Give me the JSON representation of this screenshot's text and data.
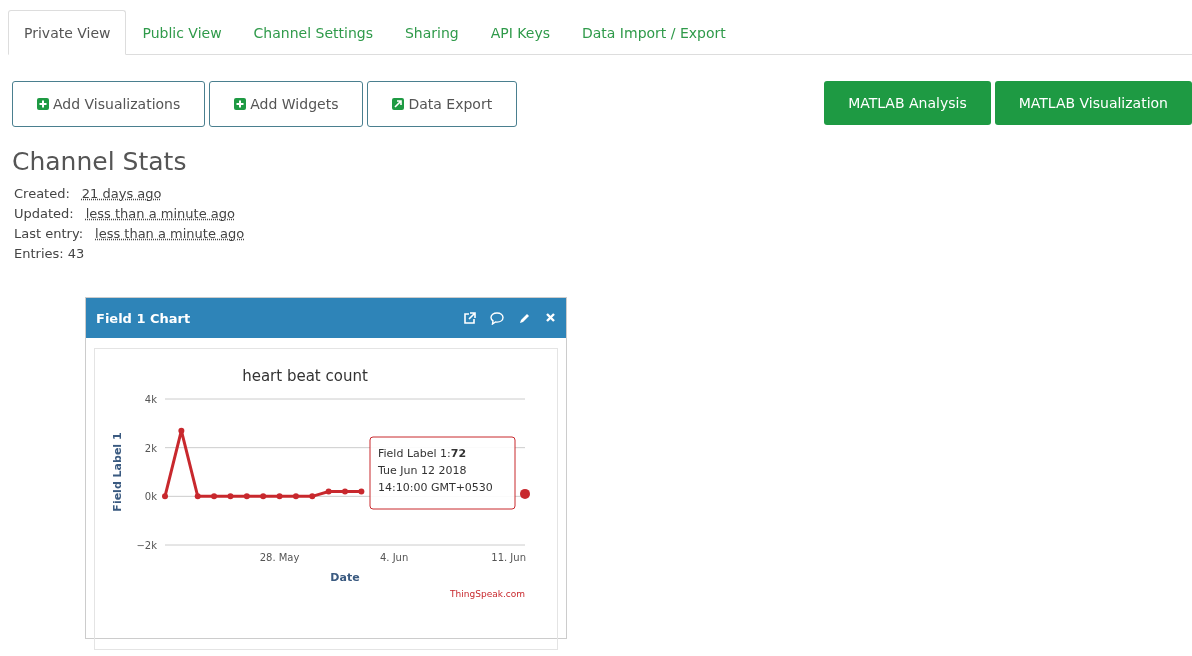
{
  "tabs": [
    {
      "label": "Private View",
      "selected": true
    },
    {
      "label": "Public View",
      "selected": false
    },
    {
      "label": "Channel Settings",
      "selected": false
    },
    {
      "label": "Sharing",
      "selected": false
    },
    {
      "label": "API Keys",
      "selected": false
    },
    {
      "label": "Data Import / Export",
      "selected": false
    }
  ],
  "toolbar": {
    "left_buttons": [
      {
        "label": "Add Visualizations",
        "kind": "add"
      },
      {
        "label": "Add Widgets",
        "kind": "add"
      },
      {
        "label": "Data Export",
        "kind": "export"
      }
    ],
    "right_buttons": [
      {
        "label": "MATLAB Analysis"
      },
      {
        "label": "MATLAB Visualization"
      }
    ]
  },
  "channel_stats": {
    "title": "Channel Stats",
    "items": [
      {
        "label": "Created:",
        "value": "21 days ago",
        "kind": "link"
      },
      {
        "label": "Updated:",
        "value": "less than a minute ago",
        "kind": "link"
      },
      {
        "label": "Last entry:",
        "value": "less than a minute ago",
        "kind": "link"
      },
      {
        "label": "Entries:",
        "value": "43",
        "kind": "plain"
      }
    ]
  },
  "chart_card": {
    "title": "Field 1 Chart",
    "credit": "ThingSpeak.com",
    "tooltip": {
      "lines": [
        "Field Label 1:**72**",
        "Tue Jun 12 2018",
        "14:10:00 GMT+0530"
      ]
    },
    "chart_data": {
      "type": "line",
      "title": "heart beat count",
      "xlabel": "Date",
      "ylabel": "Field Label 1",
      "categories": [
        null,
        null,
        null,
        null,
        null,
        null,
        null,
        "28. May",
        null,
        null,
        null,
        null,
        null,
        null,
        "4. Jun",
        null,
        null,
        null,
        null,
        null,
        null,
        "11. Jun",
        null
      ],
      "series": [
        {
          "color": "#c8282d",
          "marker": true,
          "values": [
            0,
            2700,
            0,
            0,
            0,
            0,
            0,
            0,
            0,
            0,
            200,
            200,
            200,
            null,
            null,
            null,
            null,
            null,
            null,
            null,
            null,
            null,
            100
          ]
        }
      ],
      "ylim": [
        -2000,
        4000
      ],
      "yticks": [
        {
          "value": -2000,
          "label": "−2k"
        },
        {
          "value": 0,
          "label": "0k"
        },
        {
          "value": 2000,
          "label": "2k"
        },
        {
          "value": 4000,
          "label": "4k"
        }
      ]
    }
  }
}
